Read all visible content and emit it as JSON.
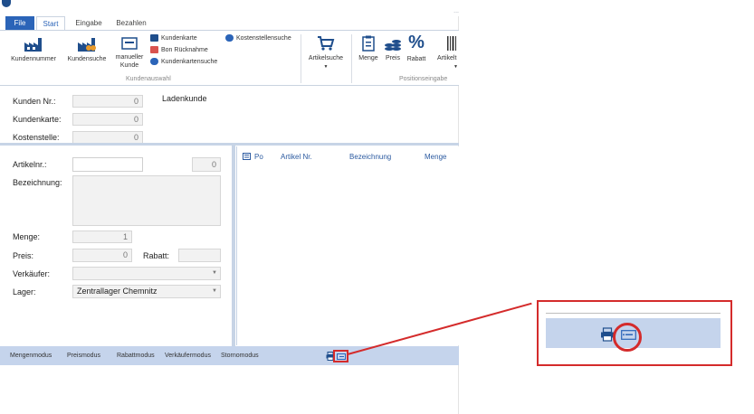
{
  "window": {
    "title_right": "..."
  },
  "tabs": [
    {
      "label": "File"
    },
    {
      "label": "Start"
    },
    {
      "label": "Eingabe"
    },
    {
      "label": "Bezahlen"
    }
  ],
  "ribbon": {
    "kundennummer": "Kundennummer",
    "kundensuche": "Kundensuche",
    "manueller_kunde_1": "manueller",
    "manueller_kunde_2": "Kunde",
    "kundenkarte": "Kundenkarte",
    "bon_ruecknahme": "Bon Rücknahme",
    "kundenkartensuche": "Kundenkartensuche",
    "kostenstellensuche": "Kostenstellensuche",
    "group_kundenauswahl": "Kundenauswahl",
    "artikelsuche": "Artikelsuche",
    "menge": "Menge",
    "preis": "Preis",
    "rabatt": "Rabatt",
    "artikel": "Artikelt",
    "group_positionseingabe": "Positionseingabe"
  },
  "customer": {
    "kunden_nr_label": "Kunden Nr.:",
    "kunden_nr_value": "0",
    "kundenkarte_label": "Kundenkarte:",
    "kundenkarte_value": "0",
    "kostenstelle_label": "Kostenstelle:",
    "kostenstelle_value": "0",
    "customer_type": "Ladenkunde"
  },
  "article": {
    "artikelnr_label": "Artikelnr.:",
    "artikelnr_value": "0",
    "bezeichnung_label": "Bezeichnung:",
    "menge_label": "Menge:",
    "menge_value": "1",
    "preis_label": "Preis:",
    "preis_value": "0",
    "rabatt_label": "Rabatt:",
    "verkaeufer_label": "Verkäufer:",
    "lager_label": "Lager:",
    "lager_value": "Zentrallager Chemnitz"
  },
  "grid": {
    "columns": [
      "Po",
      "Artikel Nr.",
      "Bezeichnung",
      "Menge"
    ]
  },
  "statusbar": {
    "items": [
      "Mengenmodus",
      "Preismodus",
      "Rabattmodus",
      "Verkäufermodus",
      "Stornomodus"
    ]
  },
  "icons": {
    "printer": "printer-icon",
    "receipt": "receipt-icon"
  },
  "colors": {
    "accent": "#2b64b8",
    "statusbar": "#c5d4ec",
    "highlight": "#d42b2b"
  }
}
